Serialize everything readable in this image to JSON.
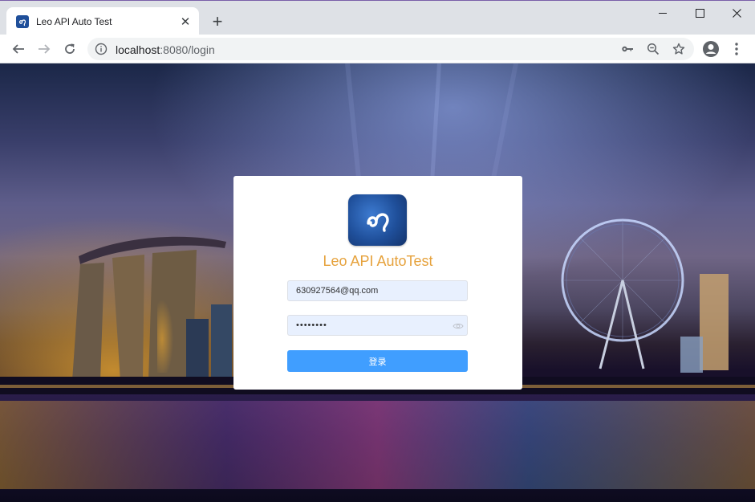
{
  "browser": {
    "tab_title": "Leo API Auto Test",
    "new_tab_label": "+",
    "url_host": "localhost",
    "url_path": ":8080/login"
  },
  "login": {
    "app_title": "Leo API AutoTest",
    "email_value": "630927564@qq.com",
    "password_value": "••••••••",
    "submit_label": "登录"
  },
  "colors": {
    "accent_title": "#e6a23c",
    "button": "#409eff",
    "input_autofill": "#e8f0fe"
  },
  "icons": [
    "info-icon",
    "key-icon",
    "zoom-icon",
    "star-icon",
    "profile-icon",
    "menu-icon",
    "eye-icon",
    "leo-logo"
  ]
}
